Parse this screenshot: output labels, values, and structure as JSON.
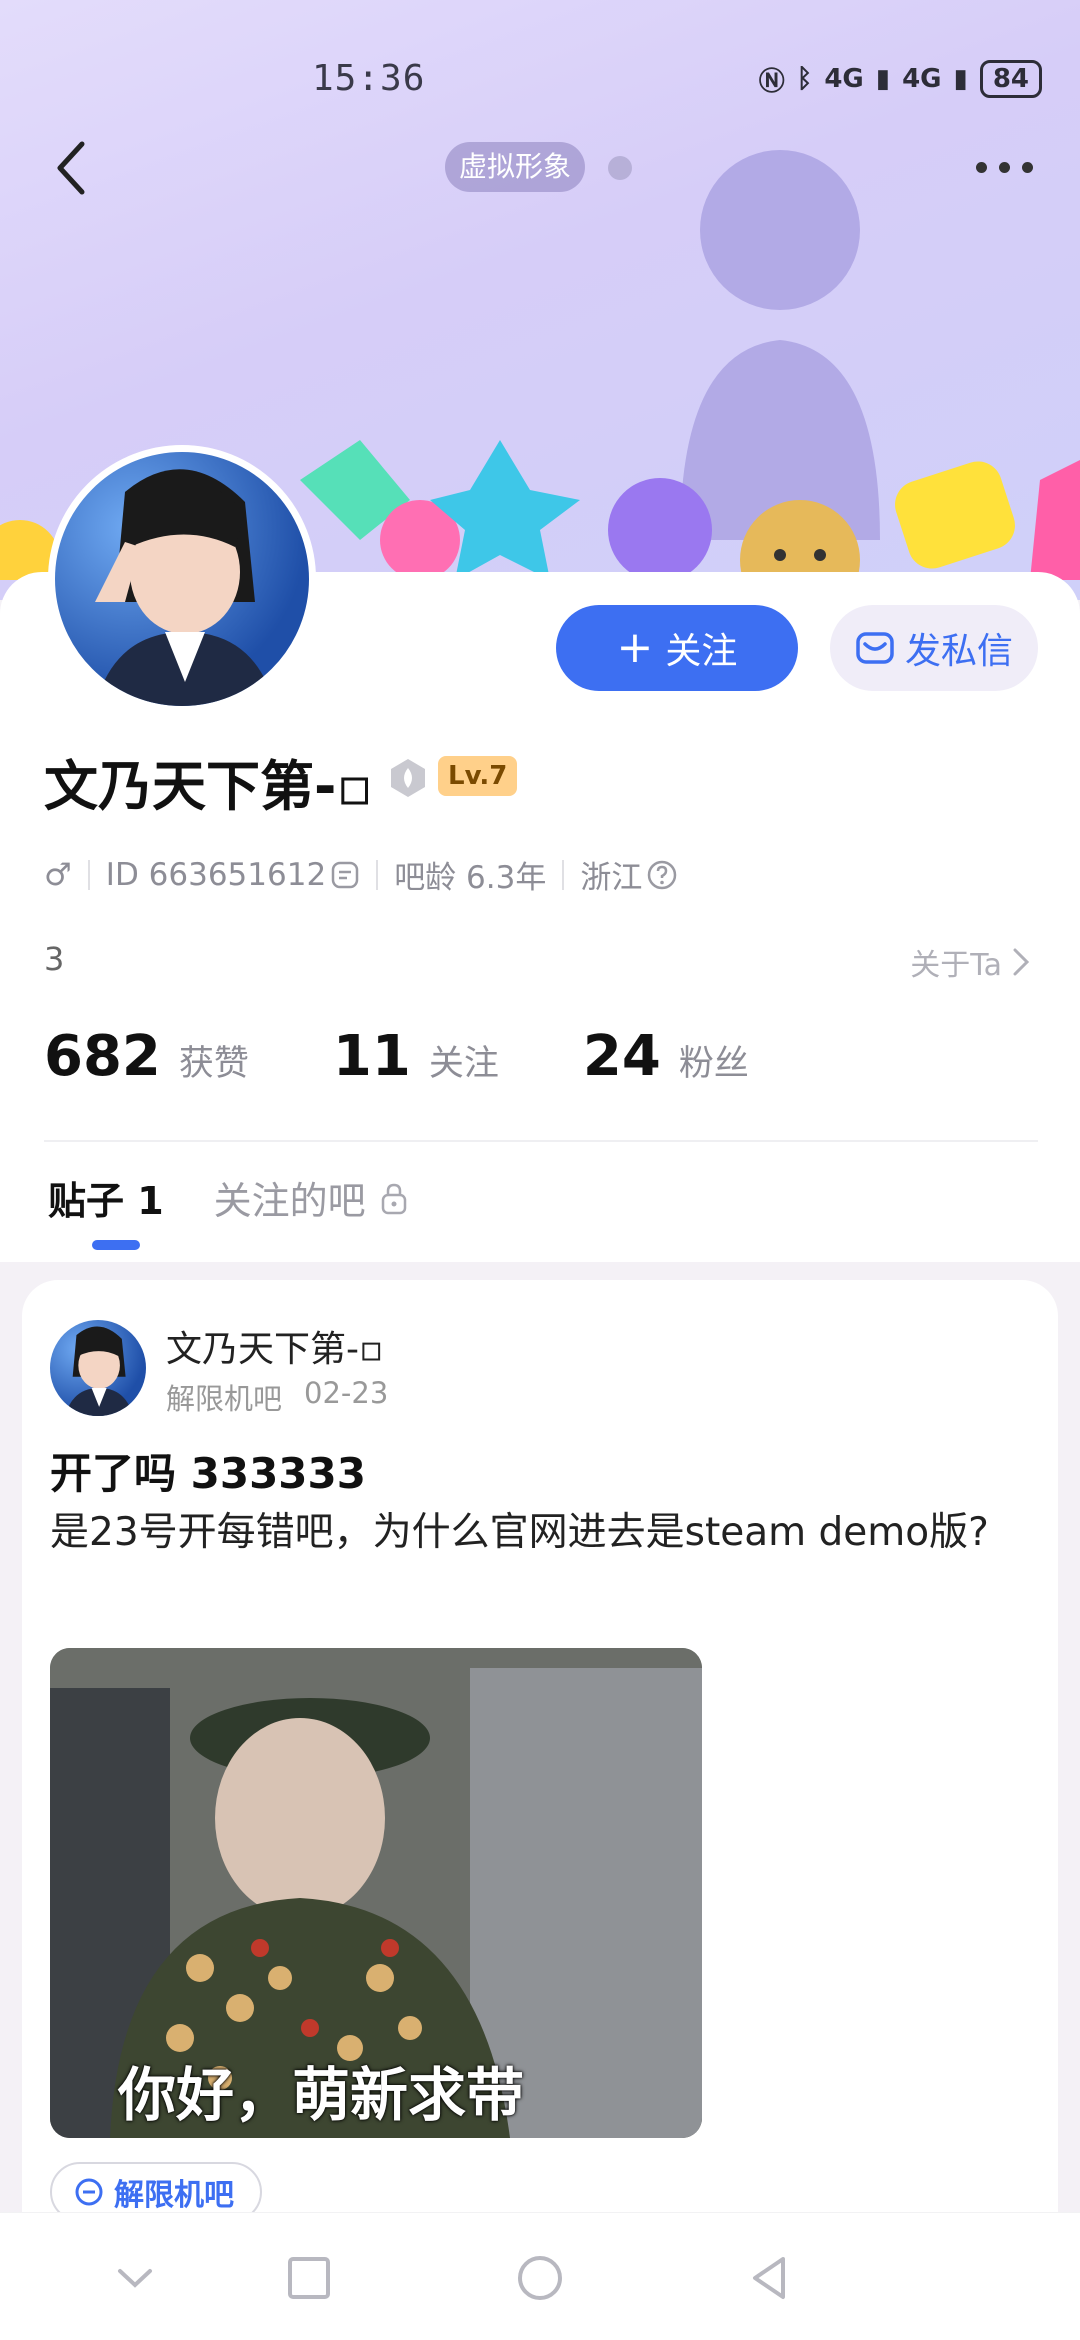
{
  "status_bar": {
    "time": "15:36",
    "battery": "84",
    "net1": "4G",
    "net2": "4G"
  },
  "header": {
    "avatar_pill": "虚拟形象"
  },
  "profile": {
    "username": "文乃天下第-▫",
    "level": "Lv.7",
    "gender_symbol": "♂",
    "id_text": "ID 663651612",
    "age_text": "吧龄 6.3年",
    "location": "浙江",
    "bio": "3",
    "about_label": "关于Ta"
  },
  "buttons": {
    "follow": "关注",
    "follow_plus": "+",
    "message": "发私信"
  },
  "stats": [
    {
      "value": "682",
      "label": "获赞"
    },
    {
      "value": "11",
      "label": "关注"
    },
    {
      "value": "24",
      "label": "粉丝"
    }
  ],
  "tabs": [
    {
      "label": "贴子 1"
    },
    {
      "label": "关注的吧"
    }
  ],
  "post": {
    "author": "文乃天下第-▫",
    "forum": "解限机吧",
    "date": "02-23",
    "title": "开了吗 333333",
    "body": "是23号开每错吧，为什么官网进去是steam demo版?",
    "image_caption": "你好，萌新求带",
    "tag": "解限机吧"
  },
  "colors": {
    "accent": "#3d6ff2",
    "hero": "#d6cdf8",
    "level_badge": "#ffd08a"
  }
}
